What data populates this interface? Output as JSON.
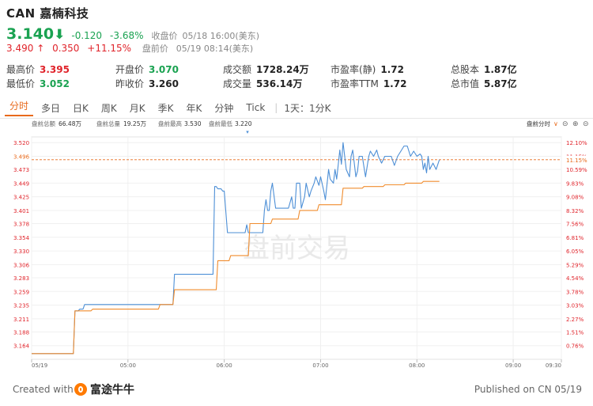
{
  "header": {
    "title": "CAN 嘉楠科技",
    "price": "3.140",
    "change": "-0.120",
    "change_pct": "-3.68%",
    "close_label": "收盘价",
    "close_time": "05/18 16:00(美东)",
    "pre_price": "3.490",
    "pre_change": "0.350",
    "pre_change_pct": "+11.15%",
    "pre_label": "盘前价",
    "pre_time": "05/19 08:14(美东)"
  },
  "stats": [
    {
      "label": "最高价",
      "value": "3.395"
    },
    {
      "label": "开盘价",
      "value": "3.070"
    },
    {
      "label": "成交额",
      "value": "1728.24万"
    },
    {
      "label": "市盈率(静)",
      "value": "1.72"
    },
    {
      "label": "总股本",
      "value": "1.87亿"
    },
    {
      "label": "最低价",
      "value": "3.052"
    },
    {
      "label": "昨收价",
      "value": "3.260"
    },
    {
      "label": "成交量",
      "value": "536.14万"
    },
    {
      "label": "市盈率TTM",
      "value": "1.72"
    },
    {
      "label": "总市值",
      "value": "5.87亿"
    }
  ],
  "tabs": [
    "分时",
    "多日",
    "日K",
    "周K",
    "月K",
    "季K",
    "年K",
    "分钟",
    "Tick",
    "1天：1分K"
  ],
  "colors": {
    "green": "#1aa251",
    "red": "#e0242b",
    "orange": "#e86a1c",
    "price_line": "#4d8fd6",
    "avg_line": "#f08c2e"
  },
  "chart_data": {
    "type": "line",
    "info": {
      "total_amount_label": "盘前总额",
      "total_amount": "66.48万",
      "total_volume_label": "盘前总量",
      "total_volume": "19.25万",
      "high_label": "盘前最高",
      "high": "3.530",
      "low_label": "盘前最低",
      "low": "3.220"
    },
    "right_title": "盘前分时",
    "watermark": "盘前交易",
    "ylim": [
      3.14,
      3.53
    ],
    "xlim": [
      "04:00",
      "09:30"
    ],
    "y_ticks": [
      "3.520",
      "3.496",
      "3.473",
      "3.449",
      "3.425",
      "3.401",
      "3.378",
      "3.354",
      "3.330",
      "3.306",
      "3.283",
      "3.259",
      "3.235",
      "3.211",
      "3.188",
      "3.164"
    ],
    "y_right_ticks": [
      "12.10%",
      "11.15%",
      "10.59%",
      "9.83%",
      "9.08%",
      "8.32%",
      "7.56%",
      "6.81%",
      "6.05%",
      "5.29%",
      "4.54%",
      "3.78%",
      "3.03%",
      "2.27%",
      "1.51%",
      "0.76%"
    ],
    "x_ticks": [
      {
        "t": "04:00",
        "label": "05/19"
      },
      {
        "t": "05:00",
        "label": "05:00"
      },
      {
        "t": "06:00",
        "label": "06:00"
      },
      {
        "t": "07:00",
        "label": "07:00"
      },
      {
        "t": "08:00",
        "label": "08:00"
      },
      {
        "t": "09:00",
        "label": "09:00"
      },
      {
        "t": "09:30",
        "label": "09:30"
      }
    ],
    "current_price": 3.49,
    "current_label": "11.15%",
    "series": [
      {
        "x": [
          "04:00",
          "04:26",
          "04:27",
          "04:29",
          "04:30",
          "04:32",
          "04:33",
          "04:37",
          "04:38",
          "05:19",
          "05:20",
          "05:28",
          "05:29",
          "05:46",
          "05:47",
          "05:53",
          "05:54",
          "05:55",
          "05:56",
          "05:58",
          "05:59",
          "06:00",
          "06:02",
          "06:03",
          "06:04",
          "06:06",
          "06:07",
          "06:08",
          "06:12",
          "06:13",
          "06:14",
          "06:15",
          "06:16",
          "06:17",
          "06:23",
          "06:24",
          "06:25",
          "06:26",
          "06:27",
          "06:28",
          "06:29",
          "06:30",
          "06:32",
          "06:33",
          "06:35",
          "06:36",
          "06:38",
          "06:39",
          "06:40",
          "06:42",
          "06:43",
          "06:44",
          "06:45",
          "06:47",
          "06:48",
          "06:50",
          "06:51",
          "06:53",
          "06:54",
          "06:56",
          "06:57",
          "06:59",
          "07:00",
          "07:02",
          "07:03",
          "07:05",
          "07:06",
          "07:08",
          "07:09",
          "07:10",
          "07:12",
          "07:13",
          "07:14",
          "07:16",
          "07:18",
          "07:19",
          "07:20",
          "07:22",
          "07:23",
          "07:24",
          "07:26",
          "07:28",
          "07:30",
          "07:31",
          "07:33",
          "07:35",
          "07:36",
          "07:38",
          "07:40",
          "07:42",
          "07:44",
          "07:46",
          "07:48",
          "07:50",
          "07:52",
          "07:54",
          "07:56",
          "07:58",
          "08:00",
          "08:02",
          "08:03",
          "08:04",
          "08:05",
          "08:06",
          "08:07",
          "08:08",
          "08:10",
          "08:12",
          "08:14"
        ],
        "y": [
          3.15,
          3.15,
          3.225,
          3.225,
          3.228,
          3.228,
          3.236,
          3.236,
          3.236,
          3.236,
          3.236,
          3.236,
          3.289,
          3.289,
          3.289,
          3.289,
          3.443,
          3.443,
          3.439,
          3.439,
          3.435,
          3.435,
          3.362,
          3.362,
          3.362,
          3.362,
          3.362,
          3.362,
          3.362,
          3.362,
          3.376,
          3.362,
          3.362,
          3.362,
          3.362,
          3.362,
          3.401,
          3.42,
          3.401,
          3.401,
          3.435,
          3.449,
          3.405,
          3.405,
          3.405,
          3.405,
          3.405,
          3.405,
          3.405,
          3.425,
          3.405,
          3.405,
          3.449,
          3.449,
          3.405,
          3.425,
          3.449,
          3.425,
          3.435,
          3.449,
          3.46,
          3.445,
          3.46,
          3.435,
          3.42,
          3.473,
          3.456,
          3.449,
          3.473,
          3.456,
          3.507,
          3.482,
          3.52,
          3.473,
          3.46,
          3.496,
          3.507,
          3.46,
          3.47,
          3.496,
          3.496,
          3.46,
          3.496,
          3.505,
          3.496,
          3.507,
          3.496,
          3.484,
          3.496,
          3.496,
          3.496,
          3.48,
          3.496,
          3.505,
          3.514,
          3.514,
          3.496,
          3.505,
          3.496,
          3.5,
          3.496,
          3.473,
          3.484,
          3.467,
          3.496,
          3.473,
          3.484,
          3.473,
          3.49
        ]
      },
      {
        "x": [
          "04:00",
          "04:26",
          "04:27",
          "04:37",
          "04:38",
          "05:19",
          "05:20",
          "05:28",
          "05:29",
          "05:46",
          "05:47",
          "05:55",
          "05:56",
          "06:03",
          "06:04",
          "06:15",
          "06:16",
          "06:29",
          "06:30",
          "06:46",
          "06:47",
          "06:58",
          "06:59",
          "07:13",
          "07:14",
          "07:26",
          "07:27",
          "07:39",
          "07:40",
          "07:52",
          "07:53",
          "08:03",
          "08:04",
          "08:14"
        ],
        "y": [
          3.15,
          3.15,
          3.225,
          3.225,
          3.228,
          3.228,
          3.236,
          3.236,
          3.262,
          3.262,
          3.262,
          3.262,
          3.313,
          3.313,
          3.322,
          3.322,
          3.378,
          3.378,
          3.386,
          3.386,
          3.401,
          3.401,
          3.411,
          3.411,
          3.44,
          3.44,
          3.443,
          3.443,
          3.446,
          3.446,
          3.449,
          3.449,
          3.452,
          3.452
        ]
      }
    ]
  },
  "footer": {
    "created_with": "Created with",
    "brand": "富途牛牛",
    "published": "Published on CN 05/19"
  }
}
